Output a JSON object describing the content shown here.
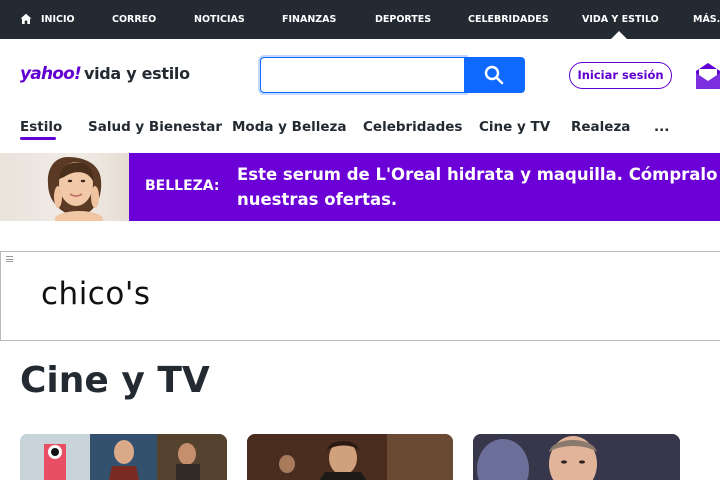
{
  "topnav": {
    "items": [
      "INICIO",
      "CORREO",
      "NOTICIAS",
      "FINANZAS",
      "DEPORTES",
      "CELEBRIDADES",
      "VIDA Y ESTILO",
      "MÁS..."
    ],
    "active": "VIDA Y ESTILO",
    "background": "#232a31"
  },
  "header": {
    "logo_yahoo": "yahoo!",
    "logo_sub": "vida y estilo",
    "search_value": "",
    "signin_label": "Iniciar sesión",
    "brand_color": "#6001d2",
    "search_button_color": "#0f69ff"
  },
  "subnav": {
    "items": [
      "Estilo",
      "Salud y Bienestar",
      "Moda y Belleza",
      "Celebridades",
      "Cine y TV",
      "Realeza",
      "..."
    ],
    "active": "Estilo"
  },
  "promo": {
    "tag": "BELLEZA:",
    "headline": "Este serum de L'Oreal hidrata y maquilla. Cómpralo en nuestras ofertas.",
    "background": "#6b00d7"
  },
  "ad": {
    "advertiser": "chico's"
  },
  "section": {
    "title": "Cine y TV"
  },
  "icons": [
    "home-icon",
    "search-icon",
    "mail-icon",
    "ad-options-icon"
  ]
}
